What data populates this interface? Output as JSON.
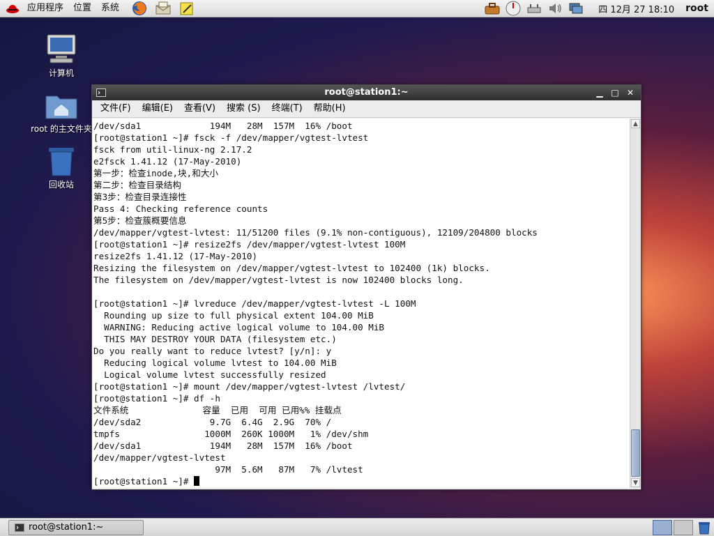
{
  "top_panel": {
    "menus": [
      "应用程序",
      "位置",
      "系统"
    ],
    "clock": "四 12月 27 18:10",
    "user": "root",
    "launchers": [
      "firefox-icon",
      "mail-icon",
      "notes-icon"
    ],
    "tray_icons": [
      "toolbox-icon",
      "clock-gauge-icon",
      "network-icon",
      "volume-icon",
      "display-icon"
    ]
  },
  "desktop": {
    "icons": [
      {
        "label": "计算机",
        "icon": "computer-icon"
      },
      {
        "label": "root 的主文件夹",
        "icon": "home-folder-icon"
      },
      {
        "label": "回收站",
        "icon": "trash-icon"
      }
    ]
  },
  "window": {
    "title": "root@station1:~",
    "menu": [
      "文件(F)",
      "编辑(E)",
      "查看(V)",
      "搜索 (S)",
      "终端(T)",
      "帮助(H)"
    ],
    "terminal_lines": [
      "/dev/sda1             194M   28M  157M  16% /boot",
      "[root@station1 ~]# fsck -f /dev/mapper/vgtest-lvtest",
      "fsck from util-linux-ng 2.17.2",
      "e2fsck 1.41.12 (17-May-2010)",
      "第一步：检查inode,块,和大小",
      "第二步：检查目录结构",
      "第3步：检查目录连接性",
      "Pass 4: Checking reference counts",
      "第5步：检查簇概要信息",
      "/dev/mapper/vgtest-lvtest: 11/51200 files (9.1% non-contiguous), 12109/204800 blocks",
      "[root@station1 ~]# resize2fs /dev/mapper/vgtest-lvtest 100M",
      "resize2fs 1.41.12 (17-May-2010)",
      "Resizing the filesystem on /dev/mapper/vgtest-lvtest to 102400 (1k) blocks.",
      "The filesystem on /dev/mapper/vgtest-lvtest is now 102400 blocks long.",
      "",
      "[root@station1 ~]# lvreduce /dev/mapper/vgtest-lvtest -L 100M",
      "  Rounding up size to full physical extent 104.00 MiB",
      "  WARNING: Reducing active logical volume to 104.00 MiB",
      "  THIS MAY DESTROY YOUR DATA (filesystem etc.)",
      "Do you really want to reduce lvtest? [y/n]: y",
      "  Reducing logical volume lvtest to 104.00 MiB",
      "  Logical volume lvtest successfully resized",
      "[root@station1 ~]# mount /dev/mapper/vgtest-lvtest /lvtest/",
      "[root@station1 ~]# df -h",
      "文件系统              容量  已用  可用 已用%% 挂载点",
      "/dev/sda2             9.7G  6.4G  2.9G  70% /",
      "tmpfs                1000M  260K 1000M   1% /dev/shm",
      "/dev/sda1             194M   28M  157M  16% /boot",
      "/dev/mapper/vgtest-lvtest",
      "                       97M  5.6M   87M   7% /lvtest"
    ],
    "prompt": "[root@station1 ~]# ",
    "scroll_position": 0.95
  },
  "taskbar": {
    "task_label": "root@station1:~",
    "workspaces": 2,
    "active_workspace": 1
  }
}
